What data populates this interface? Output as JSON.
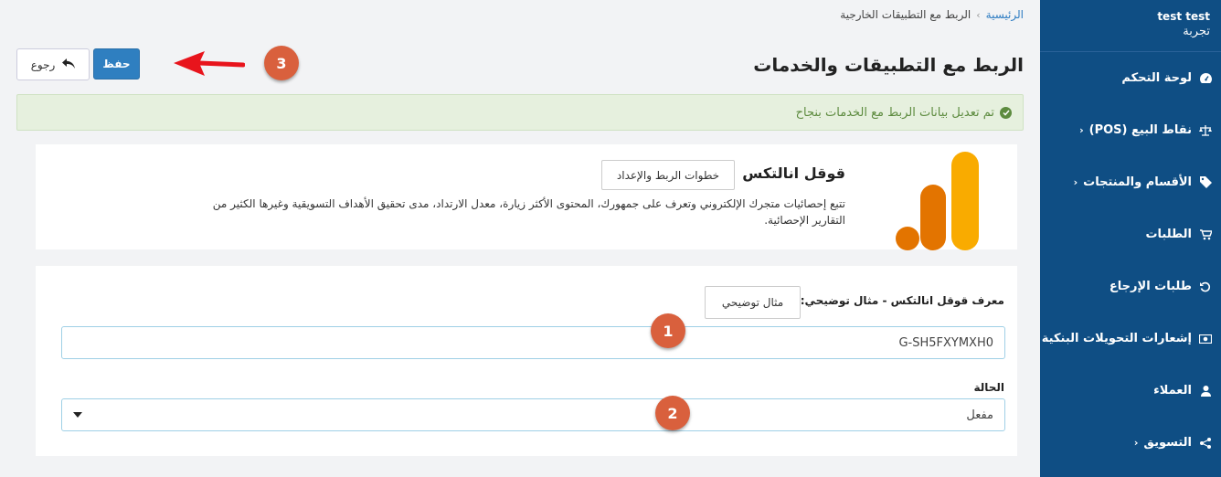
{
  "sidebar": {
    "user_name": "test test",
    "user_sub": "تجربة",
    "items": [
      {
        "label": "لوحة التحكم",
        "icon": "dashboard-icon",
        "has_chevron": false
      },
      {
        "label": "نقاط البيع (POS)",
        "icon": "balance-scale-icon",
        "has_chevron": true
      },
      {
        "label": "الأقسام والمنتجات",
        "icon": "tag-icon",
        "has_chevron": true
      },
      {
        "label": "الطلبات",
        "icon": "cart-icon",
        "has_chevron": false
      },
      {
        "label": "طلبات الإرجاع",
        "icon": "undo-icon",
        "has_chevron": false
      },
      {
        "label": "إشعارات التحويلات البنكية",
        "icon": "money-icon",
        "has_chevron": false
      },
      {
        "label": "العملاء",
        "icon": "user-icon",
        "has_chevron": false
      },
      {
        "label": "التسويق",
        "icon": "share-icon",
        "has_chevron": true
      }
    ]
  },
  "breadcrumb": {
    "home": "الرئيسية",
    "separator": "›",
    "current": "الربط مع التطبيقات الخارجية"
  },
  "header": {
    "title": "الربط مع التطبيقات والخدمات",
    "save_label": "حفظ",
    "back_label": "رجوع"
  },
  "alert": {
    "message": "تم تعديل بيانات الربط مع الخدمات بنجاح"
  },
  "integration": {
    "name": "قوقل انالتكس",
    "steps_button": "خطوات الربط والإعداد",
    "description": "تتبع إحصائيات متجرك الإلكتروني وتعرف على جمهورك، المحتوى الأكثر زيارة، معدل الارتداد، مدى تحقيق الأهداف التسويقية وغيرها الكثير من التقارير الإحصائية.",
    "logo": "google-analytics-icon"
  },
  "form": {
    "id_label": "معرف قوقل انالتكس - مثال توضيحي:",
    "example_button": "مثال توضيحي",
    "id_value": "G-SH5FXYMXH0",
    "status_label": "الحالة",
    "status_value": "مفعل"
  },
  "annotations": {
    "badge1": "1",
    "badge2": "2",
    "badge3": "3"
  },
  "colors": {
    "sidebar_bg": "#0f4e84",
    "primary": "#2f7fc0",
    "success_bg": "#e6f0de",
    "success_text": "#5d8b3f",
    "badge": "#d9603d",
    "arrow": "#e8141c",
    "logo_dark": "#e37400",
    "logo_light": "#f9ab00"
  }
}
